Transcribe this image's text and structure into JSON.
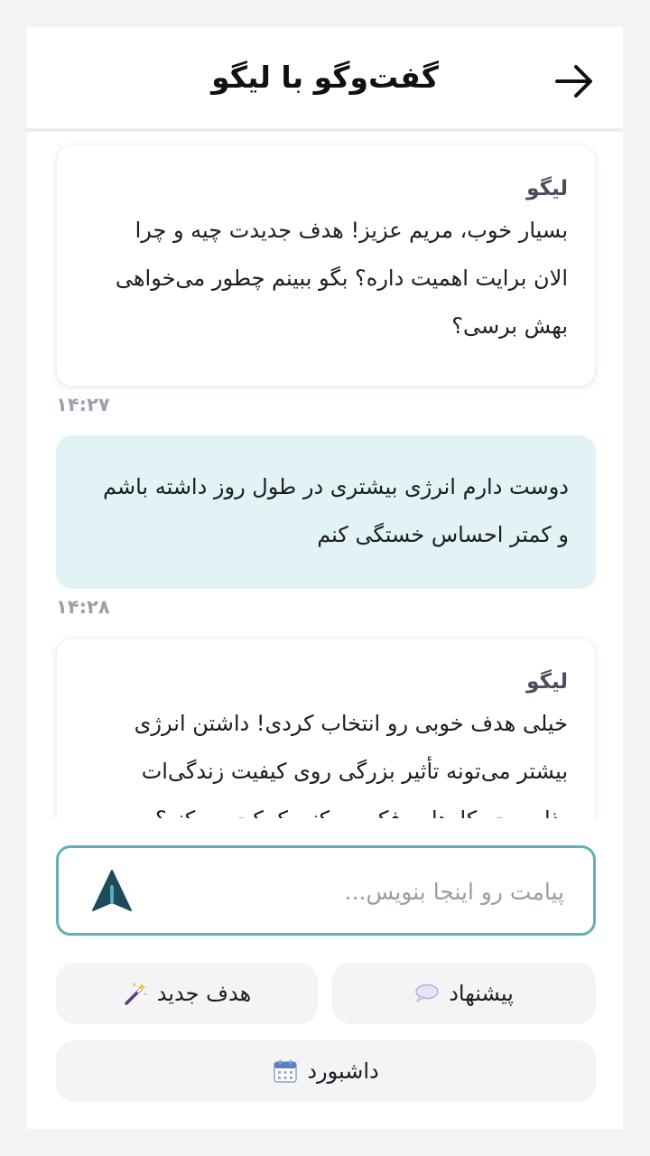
{
  "header": {
    "title": "گفت‌وگو با لیگو",
    "back_icon": "arrow-right-icon"
  },
  "messages": [
    {
      "role": "bot",
      "sender": "لیگو",
      "lines": [
        "بسیار خوب، مریم عزیز! هدف جدیدت چیه و چرا",
        "الان برایت اهمیت داره؟ بگو ببینم چطور می‌خواهی",
        "بهش برسی؟"
      ],
      "time": "۱۴:۲۷"
    },
    {
      "role": "user",
      "lines": [
        "دوست دارم انرژی بیشتری در طول روز داشته باشم",
        "و کمتر احساس خستگی کنم"
      ],
      "time": "۱۴:۲۸"
    },
    {
      "role": "bot",
      "sender": "لیگو",
      "lines": [
        "خیلی هدف خوبی رو انتخاب کردی! داشتن انرژی",
        "بیشتر می‌تونه تأثیر بزرگی روی کیفیت زندگی‌ات",
        "بذاره. چه کارهایی فکر می‌کنی کمکت می‌کنه؟"
      ]
    }
  ],
  "composer": {
    "placeholder": "پیامت رو اینجا بنویس...",
    "send_icon": "send-arrow-icon"
  },
  "actions": {
    "suggest": {
      "label": "پیشنهاد",
      "icon": "speech-bubble-icon"
    },
    "new_goal": {
      "label": "هدف جدید",
      "icon": "magic-wand-icon"
    },
    "dashboard": {
      "label": "داشبورد",
      "icon": "calendar-icon"
    }
  },
  "colors": {
    "accent": "#5fb1b6",
    "user_bubble": "#e2f3f6",
    "send_icon": "#1f4a5c",
    "send_icon_highlight": "#4fb3b8"
  }
}
